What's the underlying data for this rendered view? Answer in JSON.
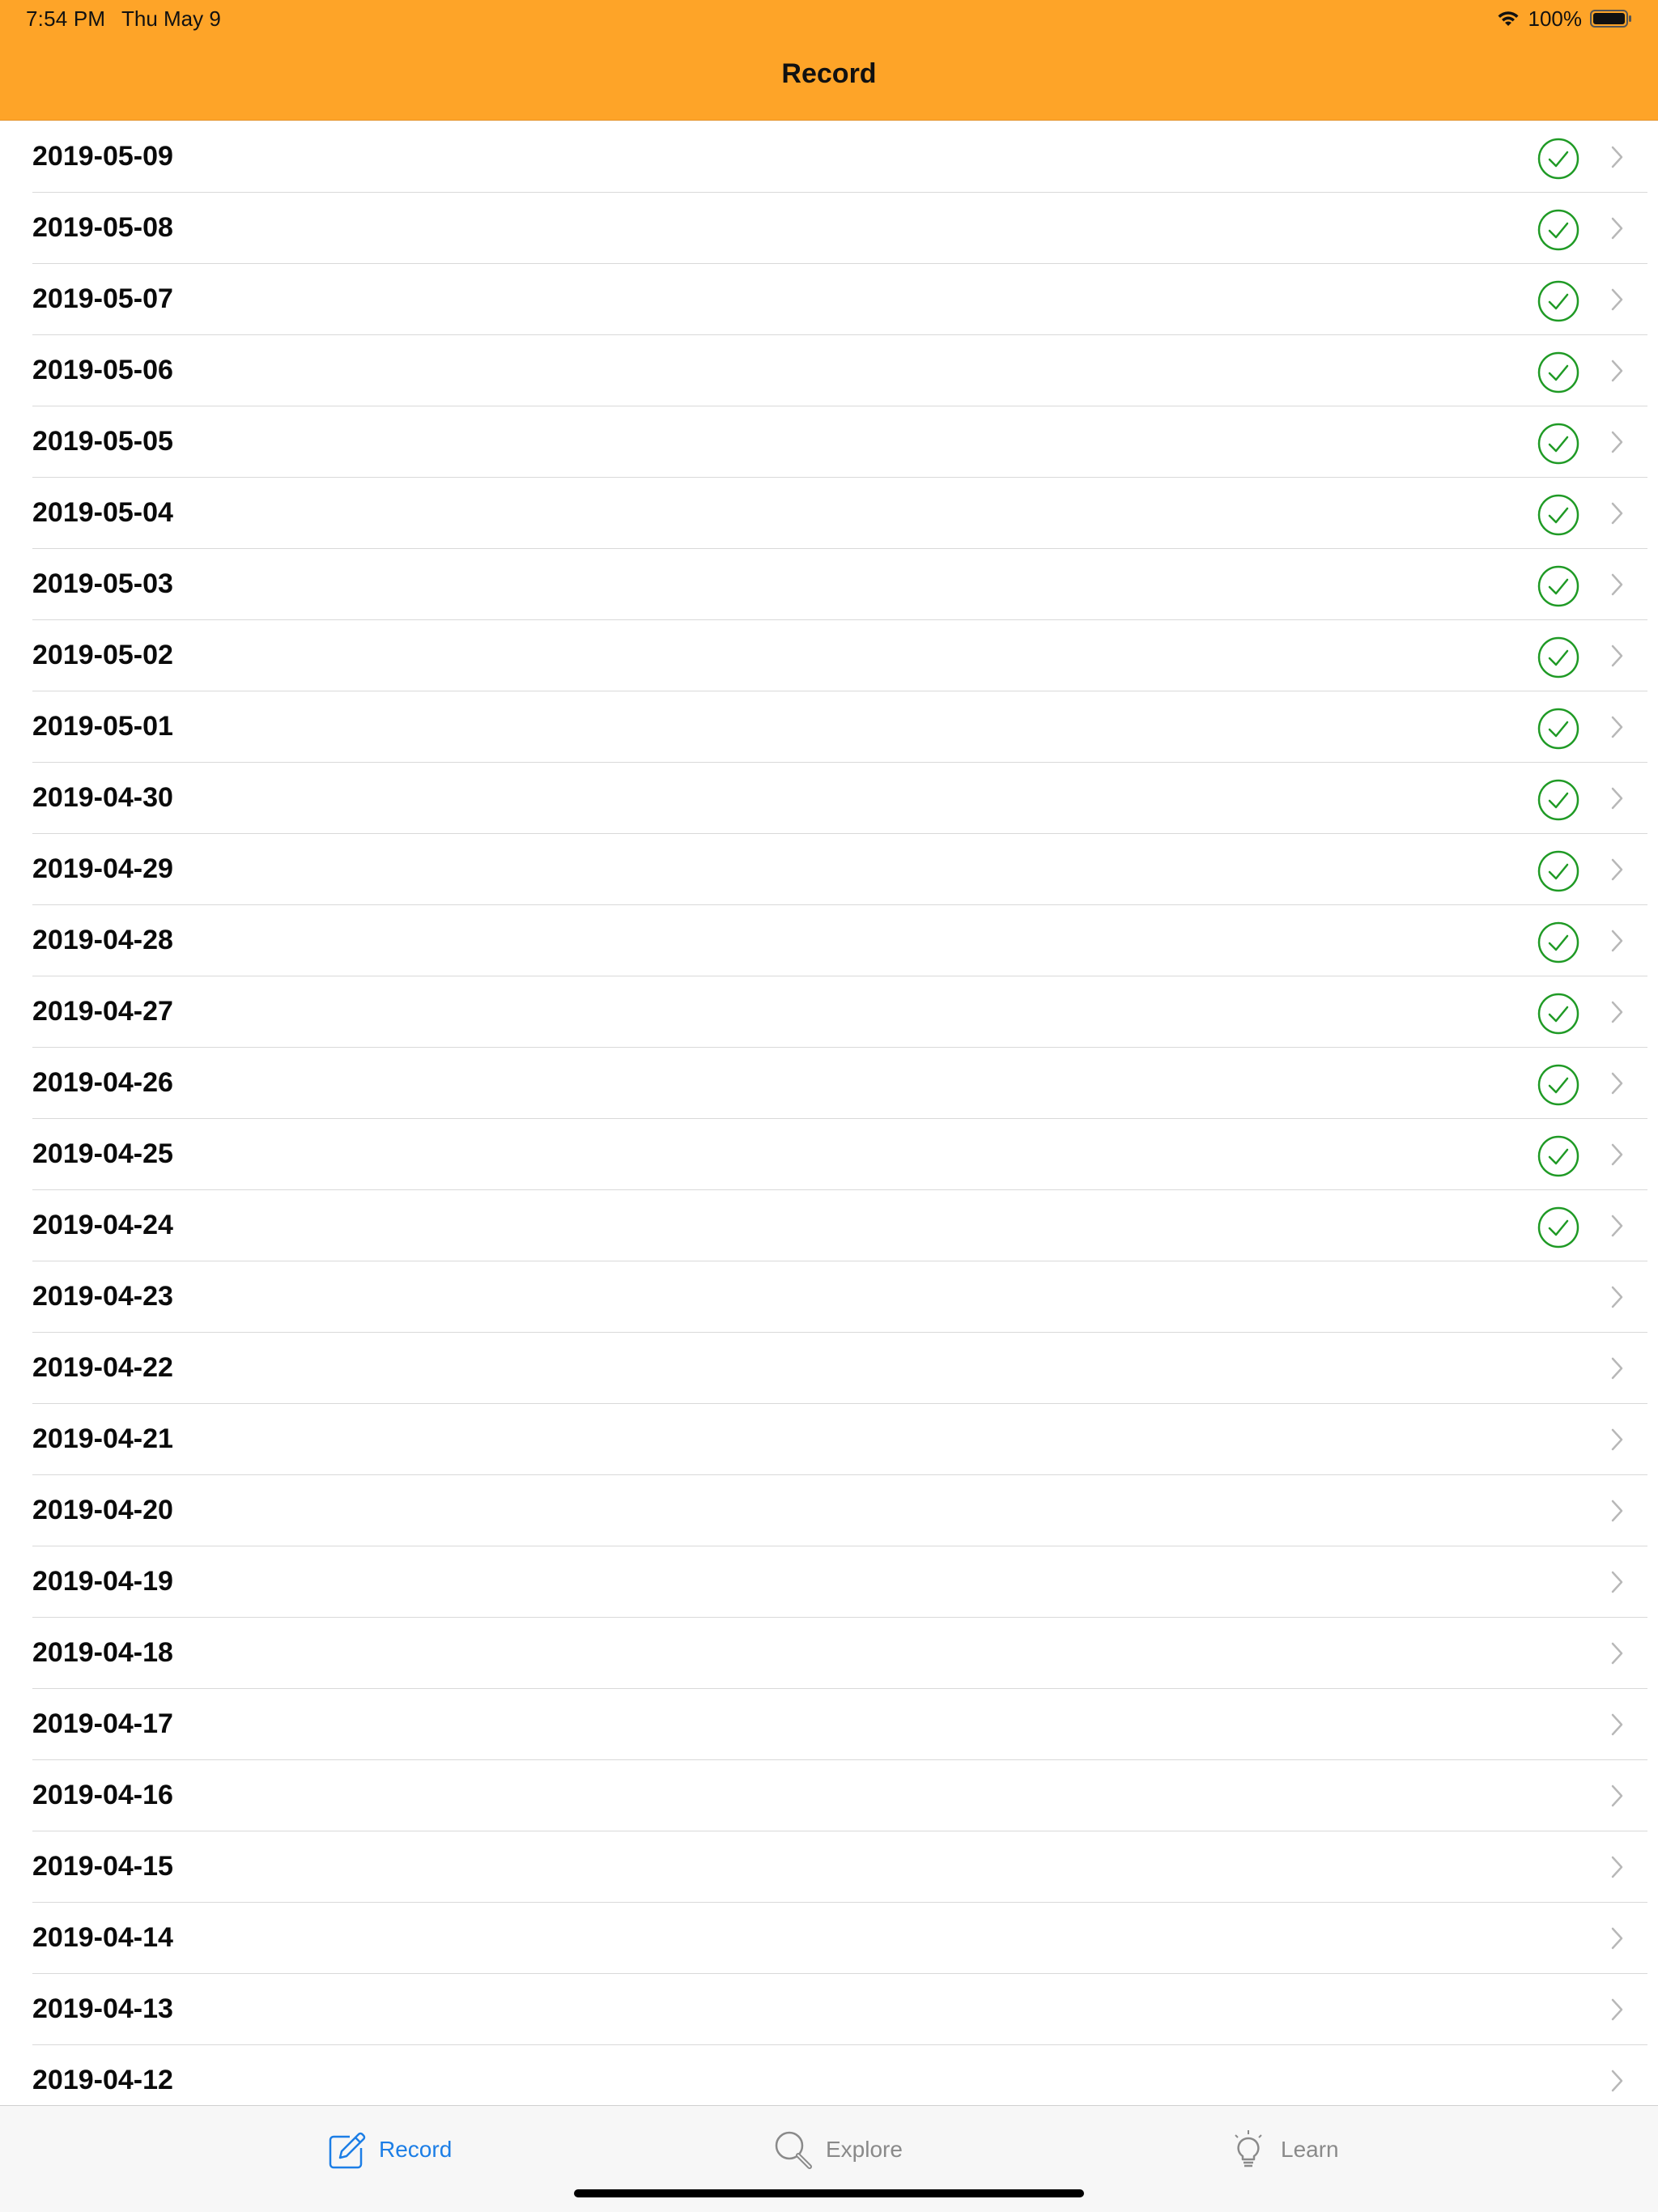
{
  "status_bar": {
    "time": "7:54 PM",
    "date": "Thu May 9",
    "battery_percent": "100%",
    "icons": [
      "wifi-icon",
      "battery-icon"
    ]
  },
  "nav": {
    "title": "Record"
  },
  "colors": {
    "accent": "#fea428",
    "check": "#1f9a25",
    "tab_active": "#1c7ee6",
    "tab_inactive": "#8a8a8a"
  },
  "records": [
    {
      "date": "2019-05-09",
      "checked": true
    },
    {
      "date": "2019-05-08",
      "checked": true
    },
    {
      "date": "2019-05-07",
      "checked": true
    },
    {
      "date": "2019-05-06",
      "checked": true
    },
    {
      "date": "2019-05-05",
      "checked": true
    },
    {
      "date": "2019-05-04",
      "checked": true
    },
    {
      "date": "2019-05-03",
      "checked": true
    },
    {
      "date": "2019-05-02",
      "checked": true
    },
    {
      "date": "2019-05-01",
      "checked": true
    },
    {
      "date": "2019-04-30",
      "checked": true
    },
    {
      "date": "2019-04-29",
      "checked": true
    },
    {
      "date": "2019-04-28",
      "checked": true
    },
    {
      "date": "2019-04-27",
      "checked": true
    },
    {
      "date": "2019-04-26",
      "checked": true
    },
    {
      "date": "2019-04-25",
      "checked": true
    },
    {
      "date": "2019-04-24",
      "checked": true
    },
    {
      "date": "2019-04-23",
      "checked": false
    },
    {
      "date": "2019-04-22",
      "checked": false
    },
    {
      "date": "2019-04-21",
      "checked": false
    },
    {
      "date": "2019-04-20",
      "checked": false
    },
    {
      "date": "2019-04-19",
      "checked": false
    },
    {
      "date": "2019-04-18",
      "checked": false
    },
    {
      "date": "2019-04-17",
      "checked": false
    },
    {
      "date": "2019-04-16",
      "checked": false
    },
    {
      "date": "2019-04-15",
      "checked": false
    },
    {
      "date": "2019-04-14",
      "checked": false
    },
    {
      "date": "2019-04-13",
      "checked": false
    },
    {
      "date": "2019-04-12",
      "checked": false
    }
  ],
  "tabs": [
    {
      "label": "Record",
      "icon": "edit-icon",
      "active": true
    },
    {
      "label": "Explore",
      "icon": "search-icon",
      "active": false
    },
    {
      "label": "Learn",
      "icon": "lightbulb-icon",
      "active": false
    }
  ]
}
